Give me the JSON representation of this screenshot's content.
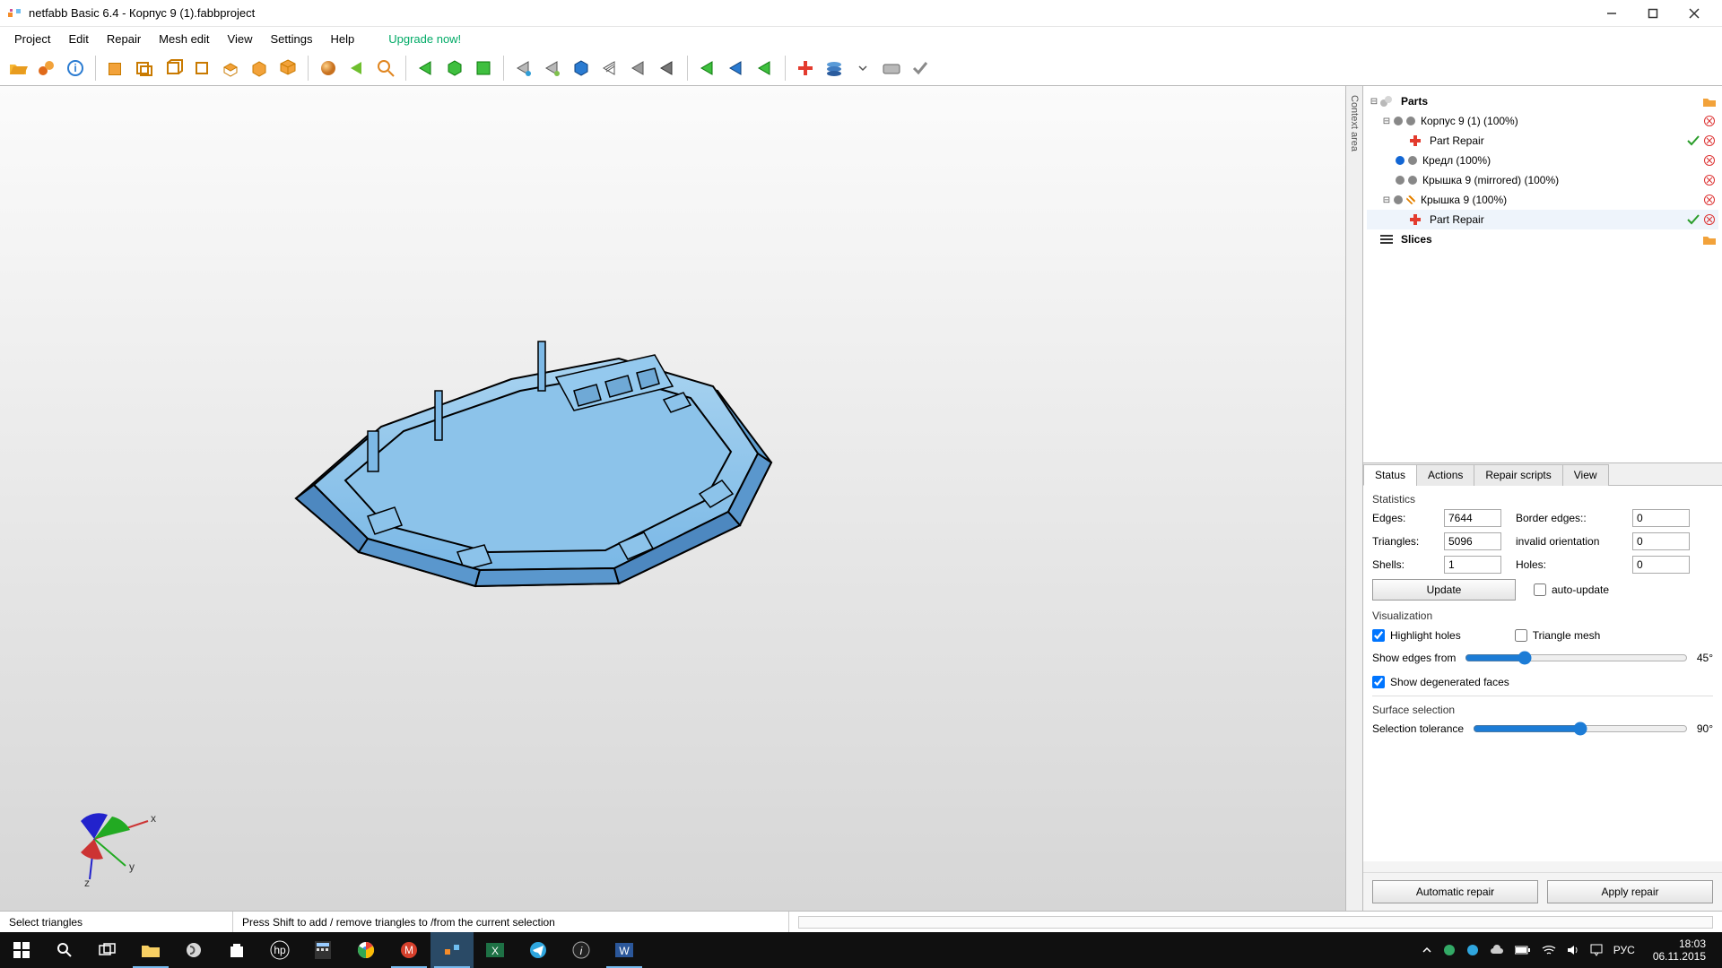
{
  "window": {
    "title": "netfabb Basic 6.4 - Корпус 9 (1).fabbproject"
  },
  "menu": {
    "items": [
      "Project",
      "Edit",
      "Repair",
      "Mesh edit",
      "View",
      "Settings",
      "Help"
    ],
    "upgrade": "Upgrade now!"
  },
  "context_label": "Context area",
  "tree": {
    "parts_label": "Parts",
    "slices_label": "Slices",
    "items": [
      {
        "label": "Корпус 9 (1) (100%)"
      },
      {
        "label": "Part Repair"
      },
      {
        "label": "Кредл (100%)"
      },
      {
        "label": "Крышка 9 (mirrored) (100%)"
      },
      {
        "label": "Крышка 9 (100%)"
      },
      {
        "label": "Part Repair"
      }
    ]
  },
  "tabs": {
    "status": "Status",
    "actions": "Actions",
    "repair_scripts": "Repair scripts",
    "view": "View"
  },
  "stats": {
    "group": "Statistics",
    "edges_label": "Edges:",
    "edges": "7644",
    "triangles_label": "Triangles:",
    "triangles": "5096",
    "shells_label": "Shells:",
    "shells": "1",
    "border_label": "Border edges::",
    "border": "0",
    "invalid_label": "invalid orientation",
    "invalid": "0",
    "holes_label": "Holes:",
    "holes": "0",
    "update": "Update",
    "auto": "auto-update"
  },
  "viz": {
    "group": "Visualization",
    "highlight": "Highlight holes",
    "tri_mesh": "Triangle mesh",
    "edges_from": "Show edges from",
    "deg45": "45°",
    "show_degen": "Show degenerated faces"
  },
  "surface": {
    "group": "Surface selection",
    "tolerance": "Selection tolerance",
    "deg90": "90°"
  },
  "actions": {
    "auto": "Automatic repair",
    "apply": "Apply repair"
  },
  "status": {
    "left": "Select triangles",
    "hint": "Press Shift to add / remove triangles to /from the current selection"
  },
  "axes": {
    "x": "x",
    "y": "y",
    "z": "z"
  },
  "taskbar": {
    "lang": "РУС",
    "time": "18:03",
    "date": "06.11.2015"
  }
}
